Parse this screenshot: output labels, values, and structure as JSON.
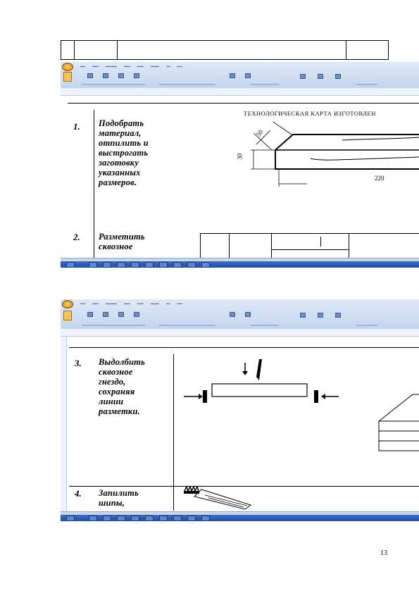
{
  "page_number": "13",
  "stamp_table": {
    "cells": [
      "",
      "",
      "",
      "",
      ""
    ]
  },
  "screen1": {
    "card_title": "ТЕХНОЛОГИЧЕСКАЯ КАРТА ИЗГОТОВЛЕН",
    "steps": [
      {
        "num": "1.",
        "text": "Подобрать\nматериал,\nотпилить и\nвыстрогать\nзаготовку\nуказанных\nразмеров."
      },
      {
        "num": "2.",
        "text": "Разметить\nсквозное"
      }
    ],
    "dimensions": {
      "thickness": "30",
      "width": "50",
      "length": "220"
    }
  },
  "screen2": {
    "steps": [
      {
        "num": "3.",
        "text": "Выдолбить\nсквозное\nгнездо,\nсохраняя\nлинии\nразметки."
      },
      {
        "num": "4.",
        "text": "Запилить\nшипы,"
      }
    ]
  }
}
